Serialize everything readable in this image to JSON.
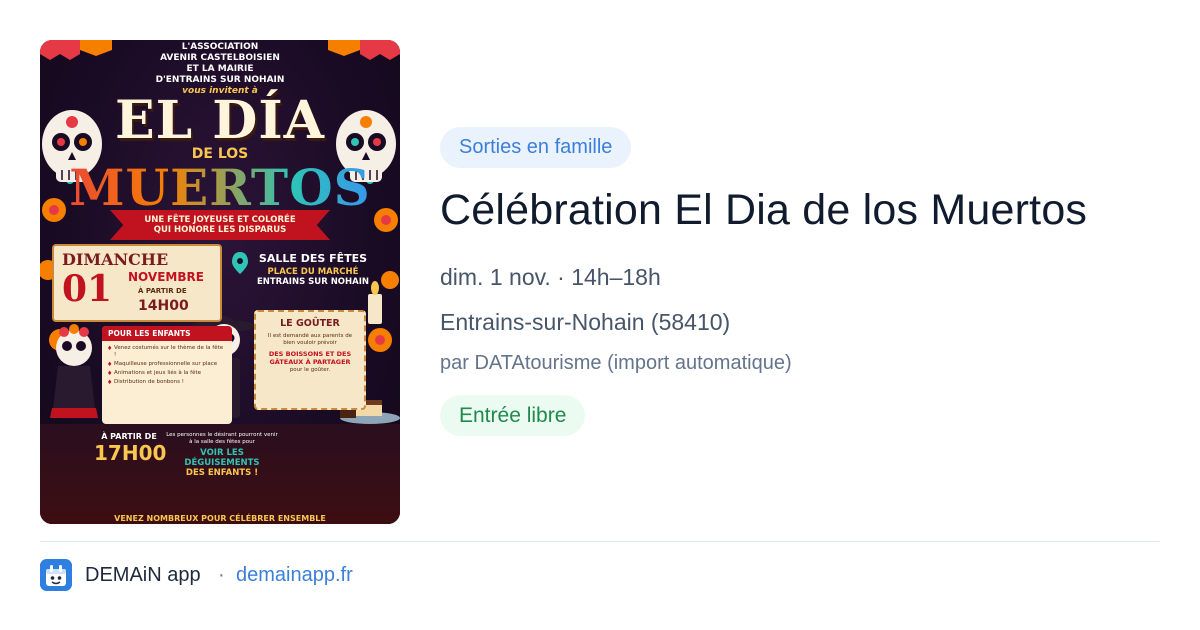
{
  "poster": {
    "association_lines": "L'ASSOCIATION\nAVENIR CASTELBOISIEN\nET LA MAIRIE\nD'ENTRAINS SUR NOHAIN",
    "invite": "vous invitent à",
    "title_line1": "EL DÍA",
    "title_line2": "DE LOS",
    "title_line3": "MUERTOS",
    "ribbon": "UNE FÊTE JOYEUSE ET COLORÉE\nQUI HONORE LES DISPARUS",
    "date_day": "DIMANCHE",
    "date_num": "01",
    "date_month": "NOVEMBRE",
    "date_from": "À PARTIR DE",
    "date_time": "14H00",
    "venue_name": "SALLE DES FÊTES",
    "venue_place": "PLACE DU MARCHÉ",
    "venue_town": "ENTRAINS SUR NOHAIN",
    "kids_title": "POUR LES ENFANTS",
    "kids_items": [
      "Venez costumés sur le thème de la fête !",
      "Maquilleuse professionnelle sur place",
      "Animations et jeux liés à la fête",
      "Distribution de bonbons !"
    ],
    "gouter_title": "LE GOÛTER",
    "gouter_text": "Il est demandé aux parents de bien vouloir prévoir",
    "gouter_items": "DES BOISSONS ET DES GÂTEAUX À PARTAGER",
    "gouter_end": "pour le goûter.",
    "evening_from": "À PARTIR DE",
    "evening_time": "17H00",
    "evening_text": "Les personnes le désirant pourront venir à la salle des fêtes pour",
    "evening_highlight1": "VOIR LES DÉGUISEMENTS",
    "evening_highlight2": "DES ENFANTS !",
    "footer": "VENEZ NOMBREUX POUR CÉLÉBRER ENSEMBLE"
  },
  "event": {
    "category": "Sorties en famille",
    "title": "Célébration El Dia de los Muertos",
    "when": "dim. 1 nov. · 14h–18h",
    "where": "Entrains-sur-Nohain (58410)",
    "by": "par DATAtourisme (import automatique)",
    "price": "Entrée libre"
  },
  "footer": {
    "app_name": "DEMAiN app",
    "separator": "·",
    "link": "demainapp.fr",
    "icon": "demain-app-icon"
  },
  "colors": {
    "accent_blue": "#3b7fd9",
    "category_bg": "#eaf2fd",
    "price_green": "#1f8a4c",
    "price_bg": "#ecfbf1"
  }
}
